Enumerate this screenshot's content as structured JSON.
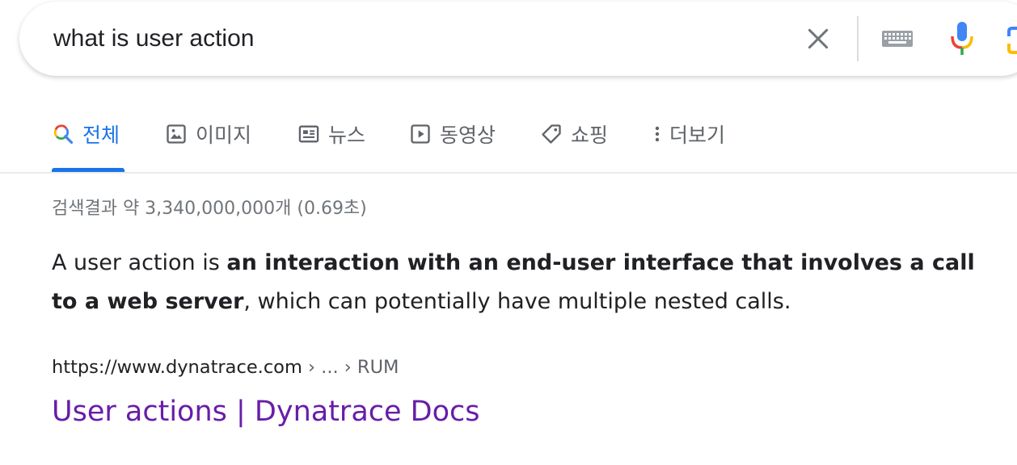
{
  "search": {
    "query": "what is user action",
    "clear_icon": "close-icon",
    "keyboard_icon": "keyboard-icon",
    "mic_icon": "microphone-icon",
    "lens_icon": "camera-lens-icon"
  },
  "tabs": [
    {
      "label": "전체",
      "icon": "search-icon",
      "active": true
    },
    {
      "label": "이미지",
      "icon": "image-icon",
      "active": false
    },
    {
      "label": "뉴스",
      "icon": "news-icon",
      "active": false
    },
    {
      "label": "동영상",
      "icon": "video-icon",
      "active": false
    },
    {
      "label": "쇼핑",
      "icon": "tag-icon",
      "active": false
    },
    {
      "label": "더보기",
      "icon": "more-vert-icon",
      "active": false
    }
  ],
  "results": {
    "stats": "검색결과 약 3,340,000,000개 (0.69초)",
    "snippet": {
      "prefix": "A user action is ",
      "bold": "an interaction with an end-user interface that involves a call to a web server",
      "suffix": ", which can potentially have multiple nested calls."
    },
    "cite": {
      "domain": "https://www.dynatrace.com",
      "crumbs": " › ... › RUM"
    },
    "title": "User actions | Dynatrace Docs"
  },
  "colors": {
    "accent": "#1a73e8",
    "visited_link": "#681da8",
    "muted_text": "#70757a",
    "icon_gray": "#5f6368"
  }
}
